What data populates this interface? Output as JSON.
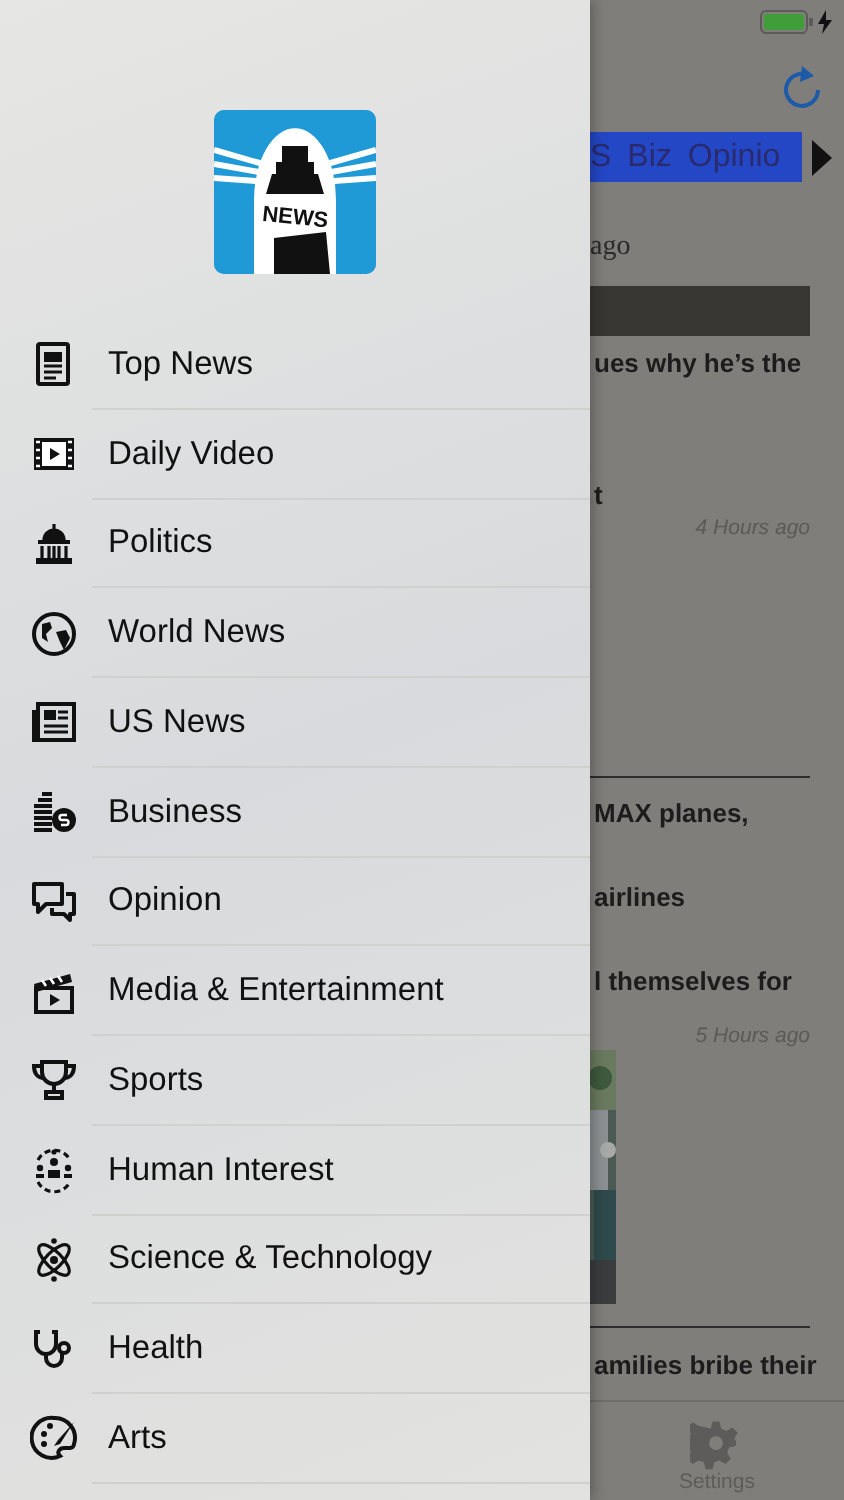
{
  "menu": {
    "logo_text": "NEWS",
    "items": [
      {
        "label": "Top News"
      },
      {
        "label": "Daily Video"
      },
      {
        "label": "Politics"
      },
      {
        "label": "World News"
      },
      {
        "label": "US News"
      },
      {
        "label": "Business"
      },
      {
        "label": "Opinion"
      },
      {
        "label": "Media & Entertainment"
      },
      {
        "label": "Sports"
      },
      {
        "label": "Human Interest"
      },
      {
        "label": "Science & Technology"
      },
      {
        "label": "Health"
      },
      {
        "label": "Arts"
      }
    ]
  },
  "background": {
    "tabs": [
      {
        "label": "S"
      },
      {
        "label": "Biz"
      },
      {
        "label": "Opinio"
      }
    ],
    "feed": [
      {
        "kind": "meta",
        "text": "ago"
      },
      {
        "kind": "banner"
      },
      {
        "kind": "headline",
        "text": "ues why he’s the"
      },
      {
        "kind": "headline",
        "text": "t"
      },
      {
        "kind": "timestamp",
        "text": "4 Hours ago"
      },
      {
        "kind": "rule"
      },
      {
        "kind": "headline",
        "text": "MAX planes,"
      },
      {
        "kind": "headline",
        "text": "airlines"
      },
      {
        "kind": "headline",
        "text": "l themselves for"
      },
      {
        "kind": "timestamp",
        "text": "5 Hours ago"
      },
      {
        "kind": "picture"
      },
      {
        "kind": "rule"
      },
      {
        "kind": "headline",
        "text": "amilies bribe their"
      }
    ],
    "tab_bar": [
      {
        "label": "Settings"
      }
    ]
  }
}
